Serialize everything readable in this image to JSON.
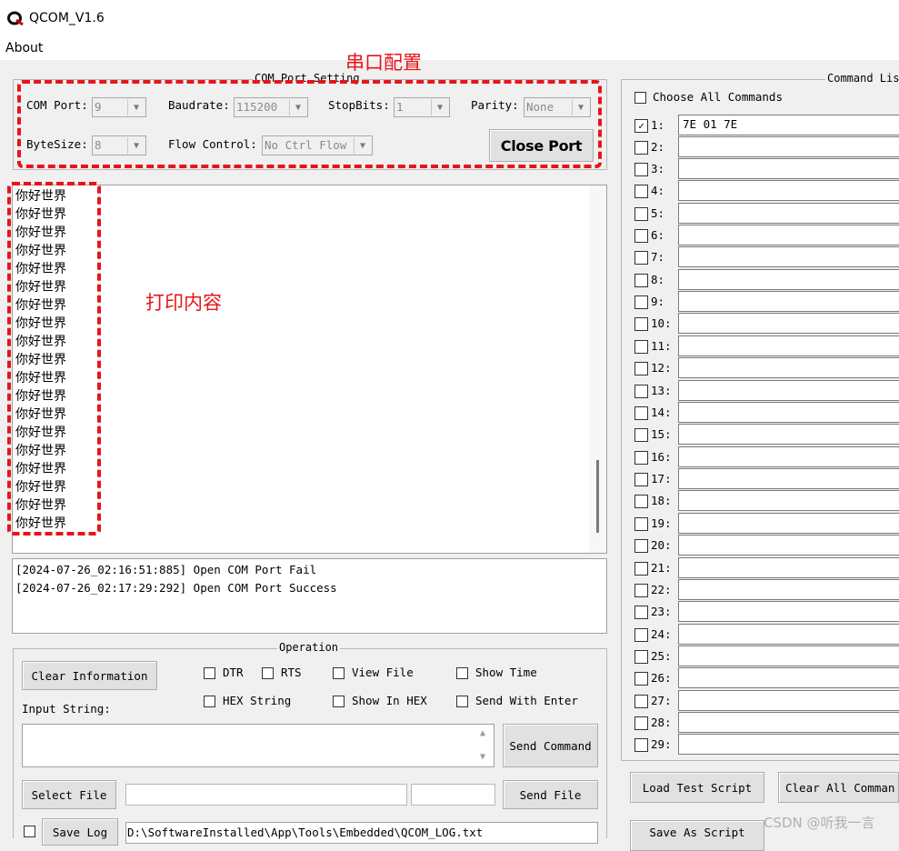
{
  "window": {
    "title": "QCOM_V1.6"
  },
  "menu": {
    "about": "About"
  },
  "com_settings": {
    "legend": "COM Port Setting",
    "com_port_label": "COM Port:",
    "com_port_value": "9",
    "baudrate_label": "Baudrate:",
    "baudrate_value": "115200",
    "stopbits_label": "StopBits:",
    "stopbits_value": "1",
    "parity_label": "Parity:",
    "parity_value": "None",
    "bytesize_label": "ByteSize:",
    "bytesize_value": "8",
    "flow_label": "Flow Control:",
    "flow_value": "No Ctrl Flow",
    "close_port": "Close Port"
  },
  "annotations": {
    "port_config": "串口配置",
    "print_content": "打印内容"
  },
  "receive": {
    "lines": [
      "你好世界",
      "你好世界",
      "你好世界",
      "你好世界",
      "你好世界",
      "你好世界",
      "你好世界",
      "你好世界",
      "你好世界",
      "你好世界",
      "你好世界",
      "你好世界",
      "你好世界",
      "你好世界",
      "你好世界",
      "你好世界",
      "你好世界",
      "你好世界",
      "你好世界"
    ]
  },
  "log": {
    "lines": [
      "[2024-07-26_02:16:51:885] Open COM Port Fail",
      "[2024-07-26_02:17:29:292] Open COM Port Success"
    ]
  },
  "operation": {
    "legend": "Operation",
    "clear_info": "Clear Information",
    "dtr": "DTR",
    "rts": "RTS",
    "view_file": "View File",
    "show_time": "Show Time",
    "hex_string": "HEX String",
    "show_in_hex": "Show In HEX",
    "send_with_enter": "Send With Enter",
    "input_label": "Input String:",
    "send_command": "Send Command",
    "select_file": "Select File",
    "send_file": "Send File",
    "save_log": "Save Log",
    "log_path": "D:\\SoftwareInstalled\\App\\Tools\\Embedded\\QCOM_LOG.txt"
  },
  "commands": {
    "legend": "Command Lis",
    "choose_all": "Choose All Commands",
    "rows": [
      {
        "num": "1:",
        "value": "7E 01 7E",
        "checked": true
      },
      {
        "num": "2:",
        "value": ""
      },
      {
        "num": "3:",
        "value": ""
      },
      {
        "num": "4:",
        "value": ""
      },
      {
        "num": "5:",
        "value": ""
      },
      {
        "num": "6:",
        "value": ""
      },
      {
        "num": "7:",
        "value": ""
      },
      {
        "num": "8:",
        "value": ""
      },
      {
        "num": "9:",
        "value": ""
      },
      {
        "num": "10:",
        "value": ""
      },
      {
        "num": "11:",
        "value": ""
      },
      {
        "num": "12:",
        "value": ""
      },
      {
        "num": "13:",
        "value": ""
      },
      {
        "num": "14:",
        "value": ""
      },
      {
        "num": "15:",
        "value": ""
      },
      {
        "num": "16:",
        "value": ""
      },
      {
        "num": "17:",
        "value": ""
      },
      {
        "num": "18:",
        "value": ""
      },
      {
        "num": "19:",
        "value": ""
      },
      {
        "num": "20:",
        "value": ""
      },
      {
        "num": "21:",
        "value": ""
      },
      {
        "num": "22:",
        "value": ""
      },
      {
        "num": "23:",
        "value": ""
      },
      {
        "num": "24:",
        "value": ""
      },
      {
        "num": "25:",
        "value": ""
      },
      {
        "num": "26:",
        "value": ""
      },
      {
        "num": "27:",
        "value": ""
      },
      {
        "num": "28:",
        "value": ""
      },
      {
        "num": "29:",
        "value": ""
      }
    ],
    "load_script": "Load Test Script",
    "clear_all": "Clear All Comman",
    "save_script": "Save As Script"
  },
  "watermark": "CSDN @听我一言"
}
